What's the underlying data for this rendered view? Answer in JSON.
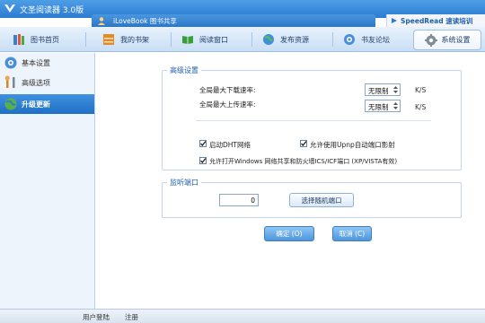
{
  "app": {
    "title": "文圣阅读器 3.0版",
    "center_tab": "iLoveBook 图书共享",
    "speedread": "SpeedRead 速读培训"
  },
  "nav": {
    "items": [
      {
        "label": "图书首页",
        "icon": "books-icon"
      },
      {
        "label": "我的书架",
        "icon": "bookshelf-icon"
      },
      {
        "label": "阅读窗口",
        "icon": "book-icon"
      },
      {
        "label": "发布资源",
        "icon": "globe-icon"
      },
      {
        "label": "书友论坛",
        "icon": "forum-icon"
      }
    ],
    "active": {
      "label": "系统设置",
      "icon": "gear-icon"
    }
  },
  "sidebar": {
    "items": [
      {
        "label": "基本设置",
        "icon": "settings-icon",
        "active": false
      },
      {
        "label": "高级选项",
        "icon": "tools-icon",
        "active": false
      },
      {
        "label": "升级更新",
        "icon": "update-globe-icon",
        "active": true
      }
    ]
  },
  "advanced": {
    "title": "高级设置",
    "download_label": "全局最大下载速率:",
    "download_value": "无限制",
    "upload_label": "全局最大上传速率:",
    "upload_value": "无限制",
    "unit": "K/S",
    "checkboxes": [
      {
        "label": "启动DHT网络",
        "checked": true
      },
      {
        "label": "允许使用Upnp自动端口影射",
        "checked": true
      },
      {
        "label": "允许打开Windows 网络共享和防火墙ICS/ICF端口 (XP/VISTA有效)",
        "checked": true
      }
    ]
  },
  "listen": {
    "title": "监听端口",
    "port_value": "0",
    "random_button": "选择随机端口"
  },
  "actions": {
    "ok": "确定 (O)",
    "cancel": "取消 (C)"
  },
  "status": {
    "login": "用户登陆",
    "register": "注册"
  },
  "colors": {
    "title_bar": "#2b7bd2",
    "accent": "#1e5fae",
    "sidebar_active": "#1f6fc4"
  }
}
